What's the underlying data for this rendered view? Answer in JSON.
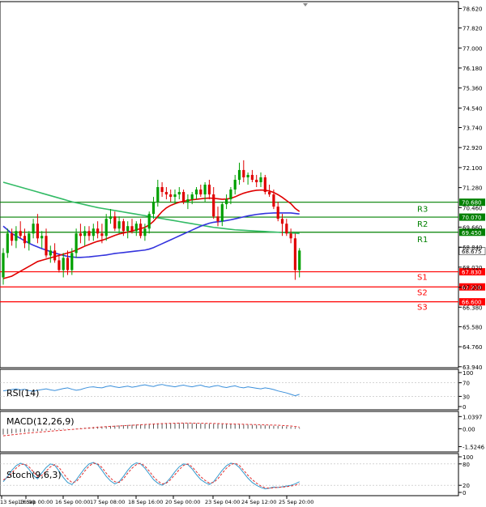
{
  "chart_data": [
    {
      "type": "candlestick",
      "panel": "price",
      "y_ticks": [
        "78.620",
        "77.820",
        "77.000",
        "76.180",
        "75.360",
        "74.540",
        "73.740",
        "72.920",
        "72.100",
        "71.280",
        "70.460",
        "69.660",
        "68.840",
        "68.020",
        "67.200",
        "66.380",
        "65.580",
        "64.760",
        "63.940"
      ],
      "x_ticks": [
        "13 Sep 16:00",
        "13 Sep 00:00",
        "16 Sep 00:00",
        "17 Sep 08:00",
        "18 Sep 16:00",
        "20 Sep 00:00",
        "23 Sep 04:00",
        "24 Sep 12:00",
        "25 Sep 20:00"
      ],
      "ylim": [
        63.9,
        78.9
      ],
      "colors": {
        "up": "#00a000",
        "down": "#e00000",
        "support": "#ff0000",
        "resistance": "#008000",
        "ma_fast": "#e00000",
        "ma_mid": "#3333dd",
        "ma_slow": "#33bb66"
      },
      "levels": [
        {
          "name": "R3",
          "value": 70.68,
          "label": "70.680",
          "kind": "resistance"
        },
        {
          "name": "R2",
          "value": 70.07,
          "label": "70.070",
          "kind": "resistance"
        },
        {
          "name": "R1",
          "value": 69.45,
          "label": "69.450",
          "kind": "resistance"
        },
        {
          "name": "S1",
          "value": 67.83,
          "label": "67.830",
          "kind": "support"
        },
        {
          "name": "S2",
          "value": 67.21,
          "label": "67.210",
          "kind": "support"
        },
        {
          "name": "S3",
          "value": 66.6,
          "label": "66.600",
          "kind": "support"
        }
      ],
      "last_price": {
        "value": 68.675,
        "label": "68.675"
      },
      "candles": [
        [
          67.6,
          68.8,
          67.3,
          68.6
        ],
        [
          68.6,
          69.6,
          68.4,
          69.4
        ],
        [
          69.4,
          69.6,
          68.9,
          69.1
        ],
        [
          69.1,
          69.7,
          68.8,
          69.5
        ],
        [
          69.5,
          69.9,
          69.2,
          69.3
        ],
        [
          69.3,
          69.6,
          68.8,
          69.0
        ],
        [
          69.0,
          69.5,
          68.7,
          69.4
        ],
        [
          69.4,
          70.0,
          69.2,
          69.8
        ],
        [
          69.8,
          70.2,
          69.0,
          69.2
        ],
        [
          69.2,
          69.5,
          68.8,
          69.3
        ],
        [
          69.3,
          69.6,
          68.4,
          68.5
        ],
        [
          68.5,
          68.9,
          68.2,
          68.7
        ],
        [
          68.7,
          69.0,
          68.2,
          68.3
        ],
        [
          68.3,
          68.5,
          67.8,
          67.9
        ],
        [
          67.9,
          68.6,
          67.6,
          68.4
        ],
        [
          68.4,
          68.7,
          67.7,
          67.9
        ],
        [
          67.9,
          68.8,
          67.7,
          68.6
        ],
        [
          68.6,
          69.6,
          68.4,
          69.4
        ],
        [
          69.4,
          69.8,
          69.0,
          69.3
        ],
        [
          69.3,
          69.7,
          68.9,
          69.5
        ],
        [
          69.5,
          69.7,
          69.1,
          69.3
        ],
        [
          69.3,
          69.8,
          69.1,
          69.6
        ],
        [
          69.6,
          69.9,
          69.2,
          69.4
        ],
        [
          69.4,
          69.8,
          69.0,
          69.3
        ],
        [
          69.3,
          70.2,
          69.1,
          70.0
        ],
        [
          70.0,
          70.4,
          69.8,
          70.1
        ],
        [
          70.1,
          70.3,
          69.5,
          69.6
        ],
        [
          69.6,
          70.1,
          69.4,
          69.9
        ],
        [
          69.9,
          70.0,
          69.3,
          69.5
        ],
        [
          69.5,
          69.9,
          69.2,
          69.7
        ],
        [
          69.7,
          70.0,
          69.4,
          69.5
        ],
        [
          69.5,
          69.9,
          69.3,
          69.8
        ],
        [
          69.8,
          70.0,
          69.2,
          69.3
        ],
        [
          69.3,
          69.8,
          69.1,
          69.6
        ],
        [
          69.6,
          70.3,
          69.4,
          70.2
        ],
        [
          70.2,
          70.9,
          70.0,
          70.7
        ],
        [
          70.7,
          71.6,
          70.5,
          71.3
        ],
        [
          71.3,
          71.5,
          70.9,
          71.1
        ],
        [
          71.1,
          71.3,
          70.8,
          71.0
        ],
        [
          71.0,
          71.2,
          70.7,
          70.9
        ],
        [
          70.9,
          71.2,
          70.6,
          71.0
        ],
        [
          71.0,
          71.3,
          70.8,
          71.1
        ],
        [
          71.1,
          71.2,
          70.6,
          70.7
        ],
        [
          70.7,
          71.0,
          70.4,
          70.8
        ],
        [
          70.8,
          71.1,
          70.6,
          71.0
        ],
        [
          71.0,
          71.3,
          70.8,
          71.2
        ],
        [
          71.2,
          71.4,
          70.9,
          71.0
        ],
        [
          71.0,
          71.5,
          70.7,
          71.4
        ],
        [
          71.4,
          71.6,
          70.8,
          71.0
        ],
        [
          71.0,
          71.3,
          70.0,
          70.1
        ],
        [
          70.1,
          70.5,
          69.7,
          69.9
        ],
        [
          69.9,
          70.7,
          69.7,
          70.6
        ],
        [
          70.6,
          71.0,
          70.4,
          70.8
        ],
        [
          70.8,
          71.3,
          70.6,
          71.2
        ],
        [
          71.2,
          71.8,
          71.0,
          71.6
        ],
        [
          71.6,
          72.3,
          71.4,
          72.0
        ],
        [
          72.0,
          72.4,
          71.5,
          71.7
        ],
        [
          71.7,
          71.9,
          71.4,
          71.8
        ],
        [
          71.8,
          72.0,
          71.5,
          71.6
        ],
        [
          71.6,
          71.8,
          71.3,
          71.5
        ],
        [
          71.5,
          71.9,
          71.3,
          71.7
        ],
        [
          71.7,
          71.8,
          71.0,
          71.1
        ],
        [
          71.1,
          71.4,
          70.9,
          71.0
        ],
        [
          71.0,
          71.2,
          70.4,
          70.5
        ],
        [
          70.5,
          70.7,
          69.9,
          70.0
        ],
        [
          70.0,
          70.2,
          69.3,
          69.8
        ],
        [
          69.8,
          70.0,
          69.3,
          69.4
        ],
        [
          69.4,
          69.6,
          69.0,
          69.2
        ],
        [
          69.2,
          69.4,
          67.5,
          67.9
        ],
        [
          67.9,
          68.8,
          67.6,
          68.7
        ]
      ],
      "ma_fast": [
        67.55,
        67.6,
        67.65,
        67.75,
        67.85,
        67.95,
        68.05,
        68.15,
        68.25,
        68.3,
        68.35,
        68.4,
        68.45,
        68.5,
        68.55,
        68.6,
        68.65,
        68.72,
        68.8,
        68.88,
        68.95,
        69.02,
        69.08,
        69.12,
        69.18,
        69.25,
        69.32,
        69.38,
        69.42,
        69.46,
        69.5,
        69.55,
        69.6,
        69.65,
        69.75,
        69.9,
        70.1,
        70.3,
        70.45,
        70.55,
        70.62,
        70.68,
        70.72,
        70.75,
        70.78,
        70.8,
        70.82,
        70.84,
        70.85,
        70.84,
        70.82,
        70.8,
        70.81,
        70.84,
        70.9,
        70.98,
        71.05,
        71.1,
        71.14,
        71.17,
        71.18,
        71.17,
        71.14,
        71.08,
        70.99,
        70.88,
        70.75,
        70.62,
        70.43,
        70.3
      ],
      "ma_mid": [
        69.7,
        69.55,
        69.4,
        69.3,
        69.2,
        69.1,
        69.0,
        68.92,
        68.85,
        68.78,
        68.72,
        68.66,
        68.6,
        68.55,
        68.5,
        68.46,
        68.44,
        68.42,
        68.42,
        68.43,
        68.44,
        68.46,
        68.48,
        68.5,
        68.52,
        68.55,
        68.58,
        68.6,
        68.62,
        68.64,
        68.66,
        68.68,
        68.7,
        68.72,
        68.76,
        68.82,
        68.9,
        68.98,
        69.06,
        69.14,
        69.22,
        69.3,
        69.38,
        69.46,
        69.54,
        69.62,
        69.7,
        69.76,
        69.82,
        69.86,
        69.88,
        69.9,
        69.93,
        69.96,
        70.0,
        70.04,
        70.08,
        70.12,
        70.15,
        70.18,
        70.2,
        70.22,
        70.23,
        70.24,
        70.24,
        70.24,
        70.24,
        70.24,
        70.22,
        70.2
      ],
      "ma_slow": [
        71.5,
        71.45,
        71.4,
        71.35,
        71.3,
        71.25,
        71.2,
        71.15,
        71.1,
        71.05,
        71.0,
        70.95,
        70.9,
        70.85,
        70.8,
        70.75,
        70.7,
        70.66,
        70.62,
        70.58,
        70.54,
        70.5,
        70.46,
        70.43,
        70.4,
        70.37,
        70.34,
        70.31,
        70.28,
        70.25,
        70.22,
        70.19,
        70.16,
        70.13,
        70.1,
        70.07,
        70.04,
        70.01,
        69.98,
        69.95,
        69.92,
        69.89,
        69.86,
        69.83,
        69.8,
        69.77,
        69.74,
        69.71,
        69.68,
        69.65,
        69.63,
        69.61,
        69.59,
        69.57,
        69.55,
        69.54,
        69.53,
        69.52,
        69.51,
        69.5,
        69.49,
        69.48,
        69.47,
        69.46,
        69.45,
        69.44,
        69.43,
        69.42,
        69.41,
        69.4
      ]
    },
    {
      "type": "line",
      "panel": "rsi",
      "legend": "RSI(14)",
      "y_ticks": [
        "100",
        "70",
        "30",
        "0"
      ],
      "ylim": [
        0,
        100
      ],
      "color": "#3a8fdb",
      "values": [
        46,
        48,
        50,
        52,
        49,
        51,
        47,
        45,
        48,
        50,
        52,
        49,
        47,
        50,
        53,
        55,
        51,
        48,
        50,
        54,
        57,
        58,
        56,
        55,
        59,
        61,
        58,
        56,
        58,
        60,
        57,
        59,
        62,
        64,
        61,
        59,
        63,
        65,
        62,
        60,
        58,
        61,
        63,
        60,
        58,
        61,
        63,
        59,
        57,
        60,
        62,
        58,
        56,
        59,
        61,
        57,
        55,
        58,
        56,
        54,
        52,
        55,
        53,
        50,
        46,
        43,
        40,
        36,
        32,
        36
      ]
    },
    {
      "type": "histogram",
      "panel": "macd",
      "legend": "MACD(12,26,9)",
      "y_ticks": [
        "1.0397",
        "0.00",
        "-1.5246"
      ],
      "ylim": [
        -1.7,
        1.2
      ],
      "colors": {
        "bars": "#555555",
        "signal": "#e03030"
      },
      "values": [
        -0.5,
        -0.45,
        -0.4,
        -0.35,
        -0.3,
        -0.28,
        -0.25,
        -0.22,
        -0.2,
        -0.18,
        -0.15,
        -0.12,
        -0.1,
        -0.08,
        -0.05,
        -0.02,
        0.0,
        0.03,
        0.06,
        0.09,
        0.12,
        0.15,
        0.18,
        0.2,
        0.22,
        0.24,
        0.26,
        0.28,
        0.3,
        0.32,
        0.34,
        0.36,
        0.38,
        0.4,
        0.42,
        0.44,
        0.46,
        0.47,
        0.48,
        0.49,
        0.5,
        0.5,
        0.49,
        0.48,
        0.47,
        0.46,
        0.45,
        0.44,
        0.43,
        0.42,
        0.41,
        0.4,
        0.39,
        0.38,
        0.37,
        0.36,
        0.35,
        0.34,
        0.33,
        0.32,
        0.31,
        0.3,
        0.28,
        0.26,
        0.24,
        0.22,
        0.2,
        0.16,
        0.12,
        0.08
      ],
      "signal": [
        -0.6,
        -0.56,
        -0.52,
        -0.48,
        -0.44,
        -0.4,
        -0.36,
        -0.33,
        -0.3,
        -0.27,
        -0.24,
        -0.21,
        -0.18,
        -0.15,
        -0.12,
        -0.09,
        -0.06,
        -0.03,
        0.0,
        0.03,
        0.06,
        0.09,
        0.12,
        0.15,
        0.18,
        0.2,
        0.22,
        0.24,
        0.26,
        0.28,
        0.3,
        0.32,
        0.34,
        0.36,
        0.38,
        0.4,
        0.42,
        0.44,
        0.45,
        0.46,
        0.47,
        0.48,
        0.48,
        0.48,
        0.48,
        0.47,
        0.47,
        0.46,
        0.46,
        0.45,
        0.44,
        0.43,
        0.42,
        0.41,
        0.4,
        0.39,
        0.38,
        0.37,
        0.36,
        0.35,
        0.34,
        0.33,
        0.32,
        0.31,
        0.3,
        0.28,
        0.26,
        0.23,
        0.19,
        0.14
      ]
    },
    {
      "type": "line",
      "panel": "stoch",
      "legend": "Stoch(9,6,3)",
      "y_ticks": [
        "100",
        "80",
        "20",
        "0"
      ],
      "ylim": [
        0,
        100
      ],
      "colors": {
        "main": "#3399cc",
        "signal": "#e03030"
      },
      "values": [
        30,
        45,
        62,
        75,
        82,
        78,
        65,
        48,
        38,
        55,
        70,
        80,
        76,
        60,
        42,
        28,
        22,
        35,
        52,
        68,
        80,
        84,
        78,
        62,
        45,
        32,
        24,
        30,
        45,
        62,
        76,
        83,
        80,
        68,
        52,
        36,
        26,
        20,
        28,
        42,
        58,
        72,
        80,
        78,
        66,
        50,
        36,
        28,
        22,
        30,
        46,
        62,
        75,
        82,
        80,
        70,
        55,
        40,
        28,
        20,
        14,
        10,
        12,
        15,
        14,
        16,
        18,
        20,
        24,
        30
      ],
      "signal": [
        35,
        42,
        55,
        68,
        78,
        80,
        72,
        58,
        45,
        48,
        60,
        72,
        78,
        70,
        54,
        38,
        28,
        30,
        44,
        60,
        74,
        82,
        80,
        70,
        54,
        40,
        30,
        28,
        38,
        54,
        68,
        78,
        82,
        74,
        60,
        44,
        32,
        24,
        26,
        36,
        50,
        64,
        76,
        80,
        72,
        58,
        44,
        34,
        26,
        28,
        38,
        54,
        68,
        78,
        82,
        76,
        62,
        48,
        36,
        26,
        18,
        13,
        12,
        13,
        14,
        15,
        16,
        18,
        20,
        24
      ]
    }
  ]
}
